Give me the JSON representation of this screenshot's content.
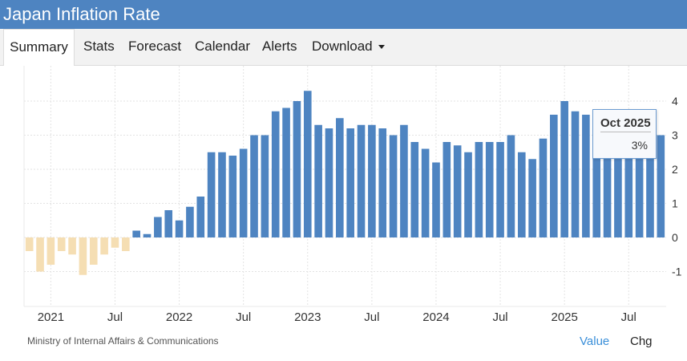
{
  "header": {
    "title": "Japan Inflation Rate"
  },
  "tabs": [
    {
      "label": "Summary",
      "active": true
    },
    {
      "label": "Stats"
    },
    {
      "label": "Forecast"
    },
    {
      "label": "Calendar"
    },
    {
      "label": "Alerts"
    },
    {
      "label": "Download",
      "has_dropdown": true
    }
  ],
  "tooltip": {
    "date": "Oct 2025",
    "value": "3%"
  },
  "footer": {
    "source": "Ministry of Internal Affairs & Communications",
    "mode_value": "Value",
    "mode_chg": "Chg"
  },
  "chart_data": {
    "type": "bar",
    "title": "",
    "xlabel": "",
    "ylabel": "",
    "ylim": [
      -1.5,
      4.5
    ],
    "yticks": [
      -1,
      0,
      1,
      2,
      3,
      4
    ],
    "x_tick_labels": [
      {
        "label": "2021",
        "month": "2021-01"
      },
      {
        "label": "Jul",
        "month": "2021-07"
      },
      {
        "label": "2022",
        "month": "2022-01"
      },
      {
        "label": "Jul",
        "month": "2022-07"
      },
      {
        "label": "2023",
        "month": "2023-01"
      },
      {
        "label": "Jul",
        "month": "2023-07"
      },
      {
        "label": "2024",
        "month": "2024-01"
      },
      {
        "label": "Jul",
        "month": "2024-07"
      },
      {
        "label": "2025",
        "month": "2025-01"
      },
      {
        "label": "Jul",
        "month": "2025-07"
      }
    ],
    "positive_color": "#4e84c1",
    "negative_color": "#f5deb3",
    "grid": true,
    "categories": [
      "2020-11",
      "2020-12",
      "2021-01",
      "2021-02",
      "2021-03",
      "2021-04",
      "2021-05",
      "2021-06",
      "2021-07",
      "2021-08",
      "2021-09",
      "2021-10",
      "2021-11",
      "2021-12",
      "2022-01",
      "2022-02",
      "2022-03",
      "2022-04",
      "2022-05",
      "2022-06",
      "2022-07",
      "2022-08",
      "2022-09",
      "2022-10",
      "2022-11",
      "2022-12",
      "2023-01",
      "2023-02",
      "2023-03",
      "2023-04",
      "2023-05",
      "2023-06",
      "2023-07",
      "2023-08",
      "2023-09",
      "2023-10",
      "2023-11",
      "2023-12",
      "2024-01",
      "2024-02",
      "2024-03",
      "2024-04",
      "2024-05",
      "2024-06",
      "2024-07",
      "2024-08",
      "2024-09",
      "2024-10",
      "2024-11",
      "2024-12",
      "2025-01",
      "2025-02",
      "2025-03",
      "2025-04",
      "2025-05",
      "2025-06",
      "2025-07",
      "2025-08",
      "2025-09",
      "2025-10"
    ],
    "values": [
      -0.4,
      -1.0,
      -0.8,
      -0.4,
      -0.5,
      -1.1,
      -0.8,
      -0.5,
      -0.3,
      -0.4,
      0.2,
      0.1,
      0.6,
      0.8,
      0.5,
      0.9,
      1.2,
      2.5,
      2.5,
      2.4,
      2.6,
      3.0,
      3.0,
      3.7,
      3.8,
      4.0,
      4.3,
      3.3,
      3.2,
      3.5,
      3.2,
      3.3,
      3.3,
      3.2,
      3.0,
      3.3,
      2.8,
      2.6,
      2.2,
      2.8,
      2.7,
      2.5,
      2.8,
      2.8,
      2.8,
      3.0,
      2.5,
      2.3,
      2.9,
      3.6,
      4.0,
      3.7,
      3.6,
      3.6,
      3.5,
      3.3,
      3.1,
      2.7,
      2.9,
      3.0
    ]
  }
}
